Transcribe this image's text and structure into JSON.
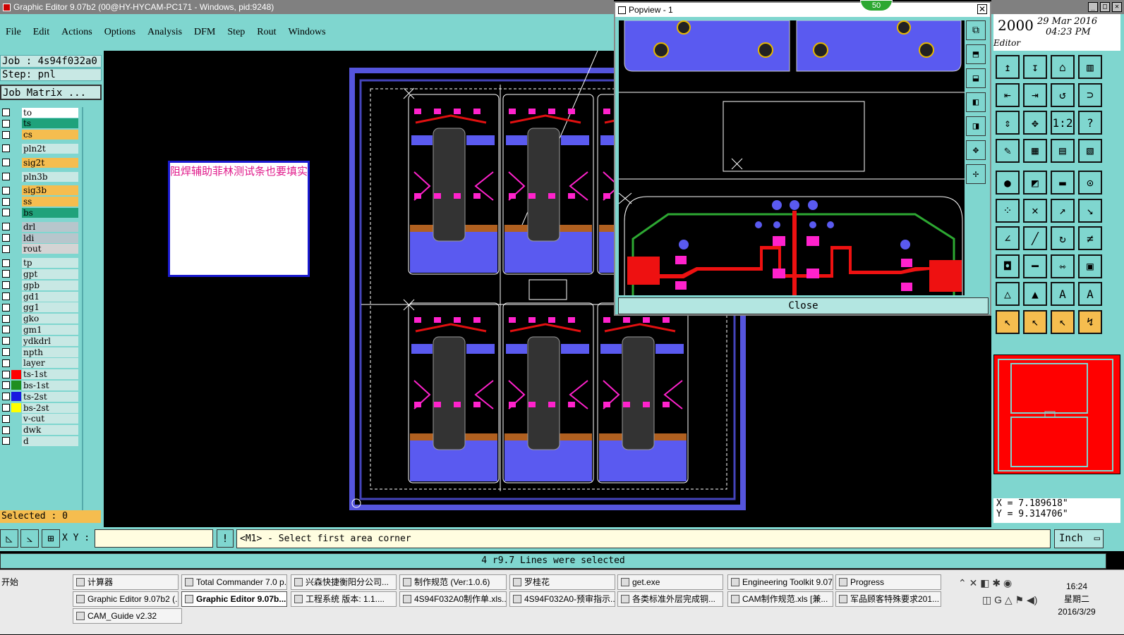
{
  "title_bar": {
    "text": "Graphic Editor 9.07b2 (00@HY-HYCAM-PC171 - Windows, pid:9248)"
  },
  "menu": [
    "File",
    "Edit",
    "Actions",
    "Options",
    "Analysis",
    "DFM",
    "Step",
    "Rout",
    "Windows"
  ],
  "left_panel": {
    "job": "Job : 4s94f032a0",
    "step": "Step: pnl",
    "matrix_button": "Job Matrix ...",
    "selected": "Selected : 0"
  },
  "layers": [
    {
      "name": "to",
      "color": "#ffffff"
    },
    {
      "name": "ts",
      "color": "#1fa27b"
    },
    {
      "name": "cs",
      "color": "#f5bd4f"
    },
    {
      "name": "pln2t",
      "color": "#c8e8e4"
    },
    {
      "name": "sig2t",
      "color": "#f5bd4f"
    },
    {
      "name": "pln3b",
      "color": "#c8e8e4"
    },
    {
      "name": "sig3b",
      "color": "#f5bd4f"
    },
    {
      "name": "ss",
      "color": "#f5bd4f"
    },
    {
      "name": "bs",
      "color": "#1fa27b"
    },
    {
      "name": "drl",
      "color": "#b7c6cc"
    },
    {
      "name": "ldi",
      "color": "#b7c6cc"
    },
    {
      "name": "rout",
      "color": "#d4d4d4"
    },
    {
      "name": "tp",
      "color": "#c8e8e4"
    },
    {
      "name": "gpt",
      "color": "#c8e8e4"
    },
    {
      "name": "gpb",
      "color": "#c8e8e4"
    },
    {
      "name": "gd1",
      "color": "#c8e8e4"
    },
    {
      "name": "gg1",
      "color": "#c8e8e4"
    },
    {
      "name": "gko",
      "color": "#c8e8e4"
    },
    {
      "name": "gm1",
      "color": "#c8e8e4"
    },
    {
      "name": "ydkdrl",
      "color": "#c8e8e4"
    },
    {
      "name": "npth",
      "color": "#c8e8e4"
    },
    {
      "name": "layer",
      "color": "#c8e8e4"
    },
    {
      "name": "ts-1st",
      "color": "#c8e8e4",
      "swatch": "#ff0000"
    },
    {
      "name": "bs-1st",
      "color": "#c8e8e4",
      "swatch": "#1f8f1f"
    },
    {
      "name": "ts-2st",
      "color": "#c8e8e4",
      "swatch": "#1a1ae0"
    },
    {
      "name": "bs-2st",
      "color": "#c8e8e4",
      "swatch": "#ffff00"
    },
    {
      "name": "v-cut",
      "color": "#c8e8e4"
    },
    {
      "name": "dwk",
      "color": "#c8e8e4"
    },
    {
      "name": "d",
      "color": "#c8e8e4"
    }
  ],
  "canvas_note": "阻焊辅助菲林测试条也要填实",
  "popview": {
    "title": "Popview - 1",
    "close_label": "Close"
  },
  "badge": "50",
  "right_panel": {
    "year": "2000",
    "date": "29 Mar 2016",
    "time": "04:23 PM",
    "app": "Editor",
    "x": "X =  7.189618\"",
    "y": "Y =  9.314706\""
  },
  "command": {
    "xy_label": "X Y :",
    "prompt": "<M1> - Select first area corner",
    "unit": "Inch"
  },
  "status": "4 r9.7 Lines were selected",
  "taskbar": {
    "start": "开始",
    "items": [
      {
        "label": "计算器"
      },
      {
        "label": "Total Commander 7.0 p..."
      },
      {
        "label": "兴森快捷衡阳分公司..."
      },
      {
        "label": "制作规范 (Ver:1.0.6)"
      },
      {
        "label": "罗桂花"
      },
      {
        "label": "get.exe"
      },
      {
        "label": "Engineering Toolkit 9.07..."
      },
      {
        "label": "Progress"
      },
      {
        "label": "Graphic Editor 9.07b2 (..."
      },
      {
        "label": "Graphic Editor 9.07b..."
      },
      {
        "label": "工程系统  版本: 1.1...."
      },
      {
        "label": "4S94F032A0制作单.xls..."
      },
      {
        "label": "4S94F032A0-预审指示..."
      },
      {
        "label": "各类标准外层完成铜..."
      },
      {
        "label": "CAM制作规范.xls [兼..."
      },
      {
        "label": "军品顾客特殊要求201..."
      },
      {
        "label": "CAM_Guide v2.32"
      }
    ],
    "clock_time": "16:24",
    "clock_day": "星期二",
    "clock_date": "2016/3/29"
  }
}
